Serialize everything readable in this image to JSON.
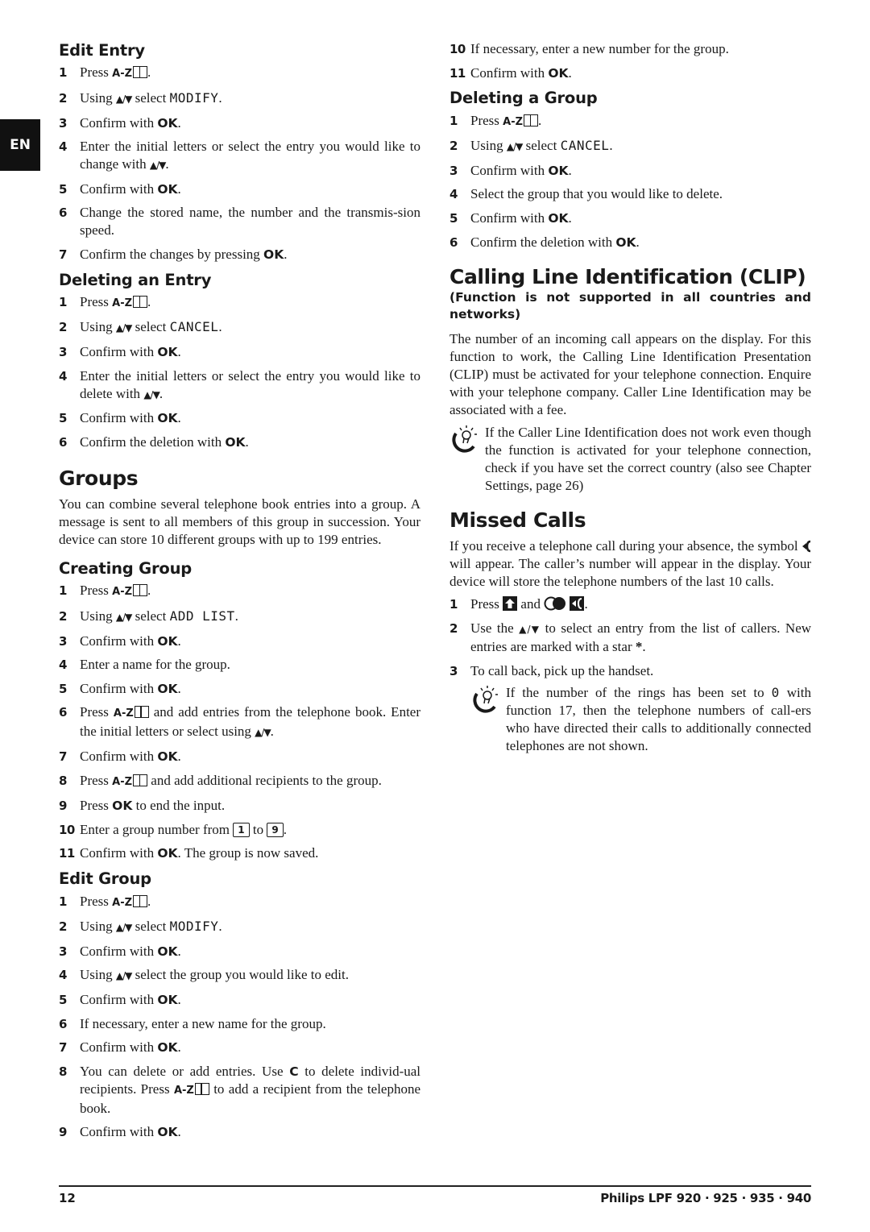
{
  "language_tab": "EN",
  "left_column": {
    "edit_entry": {
      "title": "Edit Entry",
      "steps": [
        {
          "n": "1",
          "pre": "Press",
          "key": "A-Z",
          "post": "."
        },
        {
          "n": "2",
          "pre": "Using",
          "mid": "select",
          "lcd": "MODIFY",
          "post": "."
        },
        {
          "n": "3",
          "pre": "Confirm with",
          "ok": "OK",
          "post": "."
        },
        {
          "n": "4",
          "pre": "Enter the initial letters or select the entry you would like to change with",
          "post": "."
        },
        {
          "n": "5",
          "pre": "Confirm with",
          "ok": "OK",
          "post": "."
        },
        {
          "n": "6",
          "text": "Change the stored name, the number and the transmis-sion speed."
        },
        {
          "n": "7",
          "pre": "Confirm the changes by pressing",
          "ok": "OK",
          "post": "."
        }
      ]
    },
    "deleting_entry": {
      "title": "Deleting an Entry",
      "steps": [
        {
          "n": "1",
          "pre": "Press",
          "key": "A-Z",
          "post": "."
        },
        {
          "n": "2",
          "pre": "Using",
          "mid": "select",
          "lcd": "CANCEL",
          "post": "."
        },
        {
          "n": "3",
          "pre": "Confirm with",
          "ok": "OK",
          "post": "."
        },
        {
          "n": "4",
          "pre": "Enter the initial letters or select the entry you would like to delete with",
          "post": "."
        },
        {
          "n": "5",
          "pre": "Confirm with",
          "ok": "OK",
          "post": "."
        },
        {
          "n": "6",
          "pre": "Confirm the deletion with",
          "ok": "OK",
          "post": "."
        }
      ]
    },
    "groups": {
      "title": "Groups",
      "intro": "You can combine several telephone book entries into a group. A message is sent to all members of this group in succession. Your device can store 10 different groups with up to 199 entries."
    },
    "creating_group": {
      "title": "Creating Group",
      "steps": [
        {
          "n": "1",
          "pre": "Press",
          "key": "A-Z",
          "post": "."
        },
        {
          "n": "2",
          "pre": "Using",
          "mid": "select",
          "lcd": "ADD LIST",
          "post": "."
        },
        {
          "n": "3",
          "pre": "Confirm with",
          "ok": "OK",
          "post": "."
        },
        {
          "n": "4",
          "text": "Enter a name for the group."
        },
        {
          "n": "5",
          "pre": "Confirm with",
          "ok": "OK",
          "post": "."
        },
        {
          "n": "6",
          "pre": "Press",
          "key": "A-Z",
          "post": "and add entries from the telephone book. Enter the initial letters or select using",
          "end": "."
        },
        {
          "n": "7",
          "pre": "Confirm with",
          "ok": "OK",
          "post": "."
        },
        {
          "n": "8",
          "pre": "Press",
          "key": "A-Z",
          "post": "and add additional recipients to the group."
        },
        {
          "n": "9",
          "pre": "Press",
          "ok": "OK",
          "post": "to end the input."
        },
        {
          "n": "10",
          "pre": "Enter a group number from",
          "key_from": "1",
          "mid": "to",
          "key_to": "9",
          "post": "."
        },
        {
          "n": "11",
          "pre": "Confirm with",
          "ok": "OK",
          "post": ". The group is now saved."
        }
      ]
    },
    "edit_group": {
      "title": "Edit Group",
      "steps": [
        {
          "n": "1",
          "pre": "Press",
          "key": "A-Z",
          "post": "."
        },
        {
          "n": "2",
          "pre": "Using",
          "mid": "select",
          "lcd": "MODIFY",
          "post": "."
        },
        {
          "n": "3",
          "pre": "Confirm with",
          "ok": "OK",
          "post": "."
        },
        {
          "n": "4",
          "pre": "Using",
          "post": "select the group you would like to edit."
        },
        {
          "n": "5",
          "pre": "Confirm with",
          "ok": "OK",
          "post": "."
        },
        {
          "n": "6",
          "text": "If necessary, enter a new name for the group."
        },
        {
          "n": "7",
          "pre": "Confirm with",
          "ok": "OK",
          "post": "."
        },
        {
          "n": "8",
          "pre": "You can delete or add entries. Use",
          "ok": "C",
          "mid": "to delete individ-ual recipients. Press",
          "key": "A-Z",
          "post": "to add a recipient from the telephone book."
        },
        {
          "n": "9",
          "pre": "Confirm with",
          "ok": "OK",
          "post": "."
        }
      ]
    }
  },
  "right_column": {
    "edit_group_cont": {
      "steps": [
        {
          "n": "10",
          "text": "If necessary, enter a new number for the group."
        },
        {
          "n": "11",
          "pre": "Confirm with",
          "ok": "OK",
          "post": "."
        }
      ]
    },
    "deleting_group": {
      "title": "Deleting a Group",
      "steps": [
        {
          "n": "1",
          "pre": "Press",
          "key": "A-Z",
          "post": "."
        },
        {
          "n": "2",
          "pre": "Using",
          "mid": "select",
          "lcd": "CANCEL",
          "post": "."
        },
        {
          "n": "3",
          "pre": "Confirm with",
          "ok": "OK",
          "post": "."
        },
        {
          "n": "4",
          "text": "Select the group that you would like to delete."
        },
        {
          "n": "5",
          "pre": "Confirm with",
          "ok": "OK",
          "post": "."
        },
        {
          "n": "6",
          "pre": "Confirm the deletion with",
          "ok": "OK",
          "post": "."
        }
      ]
    },
    "clip": {
      "title": "Calling Line Identification (CLIP)",
      "note": "(Function is not supported in all countries and networks)",
      "body": "The number of an incoming call appears on the display. For this function to work, the Calling Line Identification Presentation (CLIP) must be activated for your telephone connection. Enquire with your telephone company. Caller Line Identification may be associated with a fee.",
      "tip": "If the Caller Line Identification does not work even though the function is activated for your telephone connection, check if you have set the correct country (also see Chapter Settings, page 26)"
    },
    "missed_calls": {
      "title": "Missed Calls",
      "body_pre": "If you receive a telephone call during your absence, the symbol",
      "body_post": "will appear. The caller’s number will appear in the display. Your device will store the telephone numbers of the last 10 calls.",
      "steps": [
        {
          "n": "1",
          "pre": "Press",
          "mid": "and",
          "post": "."
        },
        {
          "n": "2",
          "pre": "Use the",
          "post": "to select an entry from the list of callers. New entries are marked with a star",
          "star": "*",
          "end": "."
        },
        {
          "n": "3",
          "text": "To call back, pick up the handset."
        }
      ],
      "tip_pre": "If the number of the rings has been set to",
      "tip_lcd": "0",
      "tip_post": "with function 17, then the telephone numbers of call-ers who have directed their calls to additionally connected telephones are not shown."
    }
  },
  "footer": {
    "page_number": "12",
    "model": "Philips LPF 920 · 925 · 935 · 940"
  },
  "glyphs": {
    "arrows": "▲/▼",
    "book_icon": "book-icon",
    "bulb_icon": "lightbulb-tip-icon",
    "shift_icon": "shift-key-icon",
    "missed_call_icon": "missed-call-icon",
    "cd_icon": "cd-key-icon"
  }
}
